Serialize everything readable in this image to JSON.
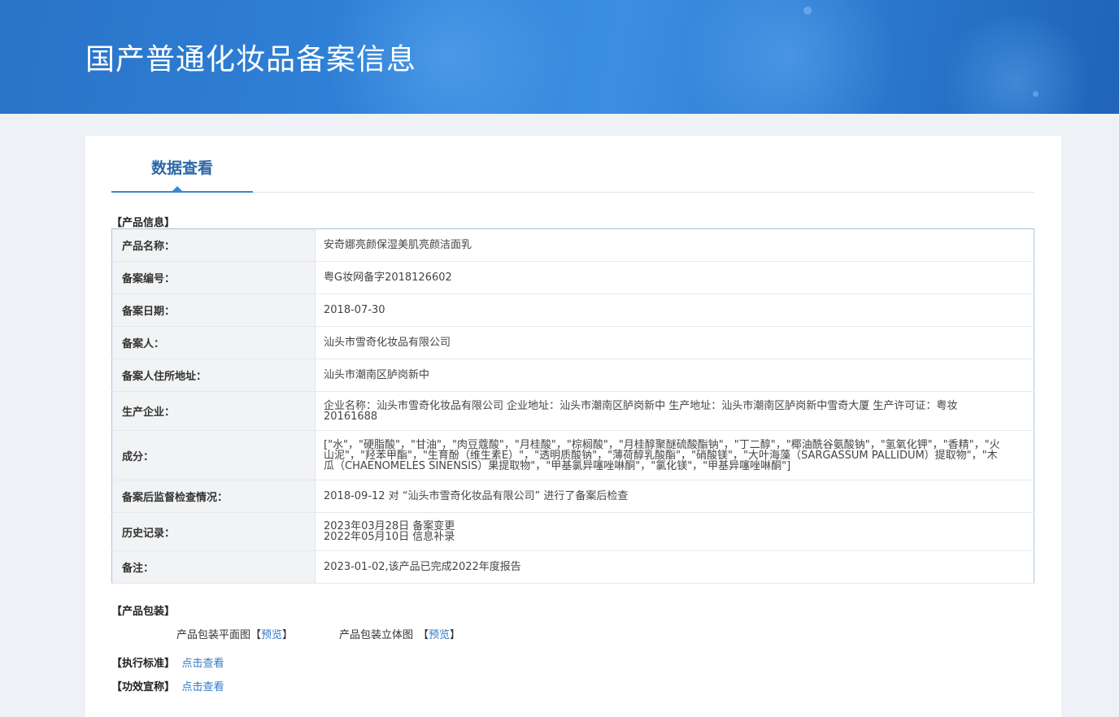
{
  "page": {
    "title": "国产普通化妆品备案信息"
  },
  "tab": {
    "label": "数据查看"
  },
  "product_info": {
    "section_title": "【产品信息】",
    "rows": [
      {
        "label": "产品名称：",
        "value": "安奇娜亮颜保湿美肌亮颜洁面乳"
      },
      {
        "label": "备案编号：",
        "value": "粤G妆网备字2018126602"
      },
      {
        "label": "备案日期：",
        "value": "2018-07-30"
      },
      {
        "label": "备案人：",
        "value": "汕头市雪奇化妆品有限公司"
      },
      {
        "label": "备案人住所地址：",
        "value": "汕头市潮南区胪岗新中"
      },
      {
        "label": "生产企业：",
        "value": "企业名称：汕头市雪奇化妆品有限公司 企业地址：汕头市潮南区胪岗新中 生产地址：汕头市潮南区胪岗新中雪奇大厦 生产许可证：粤妆20161688"
      },
      {
        "label": "成分：",
        "value": "[\"水\"，\"硬脂酸\"，\"甘油\"，\"肉豆蔻酸\"，\"月桂酸\"，\"棕榈酸\"，\"月桂醇聚醚硫酸酯钠\"，\"丁二醇\"，\"椰油酰谷氨酸钠\"，\"氢氧化钾\"，\"香精\"，\"火山泥\"，\"羟苯甲酯\"，\"生育酚（维生素E）\"，\"透明质酸钠\"，\"薄荷醇乳酸酯\"，\"硝酸镁\"，\"大叶海藻（SARGASSUM PALLIDUM）提取物\"，\"木瓜（CHAENOMELES SINENSIS）果提取物\"，\"甲基氯异噻唑啉酮\"，\"氯化镁\"，\"甲基异噻唑啉酮\"]"
      },
      {
        "label": "备案后监督检查情况：",
        "value": "2018-09-12 对 “汕头市雪奇化妆品有限公司” 进行了备案后检查"
      },
      {
        "label": "历史记录：",
        "value": "2023年03月28日 备案变更\n2022年05月10日 信息补录"
      },
      {
        "label": "备注：",
        "value": "2023-01-02,该产品已完成2022年度报告"
      }
    ]
  },
  "packaging": {
    "section_title": "【产品包装】",
    "flat_label": "产品包装平面图",
    "stereo_label": "产品包装立体图",
    "bracket_open": "【",
    "bracket_close": "】",
    "preview_link": "预览"
  },
  "standard": {
    "section_title": "【执行标准】",
    "link": "点击查看"
  },
  "efficacy": {
    "section_title": "【功效宣称】",
    "link": "点击查看"
  },
  "colors": {
    "banner": "#2f82d8",
    "accent": "#3a86d6",
    "link": "#2f7ac9",
    "table_border": "#a9c3e2"
  }
}
